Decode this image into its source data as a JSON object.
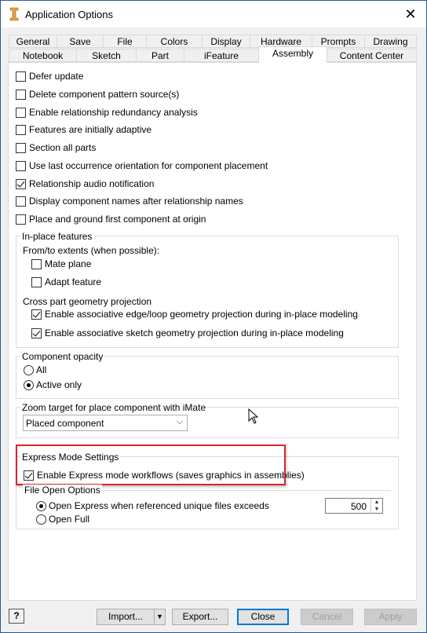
{
  "window": {
    "title": "Application Options",
    "close": "✕"
  },
  "tabs_row1": [
    "General",
    "Save",
    "File",
    "Colors",
    "Display",
    "Hardware",
    "Prompts",
    "Drawing"
  ],
  "tabs_row2": [
    "Notebook",
    "Sketch",
    "Part",
    "iFeature",
    "Assembly",
    "Content Center"
  ],
  "active_tab": "Assembly",
  "options": [
    {
      "label": "Defer update",
      "checked": false
    },
    {
      "label": "Delete component pattern source(s)",
      "checked": false
    },
    {
      "label": "Enable relationship redundancy analysis",
      "checked": false
    },
    {
      "label": "Features are initially adaptive",
      "checked": false
    },
    {
      "label": "Section all parts",
      "checked": false
    },
    {
      "label": "Use last occurrence orientation for component placement",
      "checked": false
    },
    {
      "label": "Relationship audio notification",
      "checked": true
    },
    {
      "label": "Display component names after relationship names",
      "checked": false
    },
    {
      "label": "Place and ground first component at origin",
      "checked": false
    }
  ],
  "inplace": {
    "title": "In-place features",
    "extents_label": "From/to extents (when possible):",
    "mate_plane": {
      "label": "Mate plane",
      "checked": false
    },
    "adapt_feature": {
      "label": "Adapt feature",
      "checked": false
    },
    "projection_label": "Cross part geometry projection",
    "edge_loop": {
      "label": "Enable associative edge/loop geometry projection during in-place modeling",
      "checked": true
    },
    "sketch_geom": {
      "label": "Enable associative sketch geometry projection during in-place modeling",
      "checked": true
    }
  },
  "opacity": {
    "title": "Component opacity",
    "all": {
      "label": "All",
      "selected": false
    },
    "active": {
      "label": "Active only",
      "selected": true
    }
  },
  "zoom": {
    "title": "Zoom target for place component with iMate",
    "value": "Placed component",
    "arrow": "⌵"
  },
  "express": {
    "title": "Express Mode Settings",
    "enable": {
      "label": "Enable Express mode workflows (saves graphics in assemblies)",
      "checked": true
    },
    "file_open_title": "File Open Options",
    "open_express": {
      "label": "Open Express when referenced unique files exceeds",
      "selected": true
    },
    "open_full": {
      "label": "Open Full",
      "selected": false
    },
    "threshold": "500"
  },
  "buttons": {
    "help": "?",
    "import": "Import...",
    "import_arrow": "▼",
    "export": "Export...",
    "close": "Close",
    "cancel": "Cancel",
    "apply": "Apply"
  },
  "colors": {
    "highlight": "#d9242b",
    "accent": "#0078d7",
    "title_icon": "#e8a33c"
  }
}
